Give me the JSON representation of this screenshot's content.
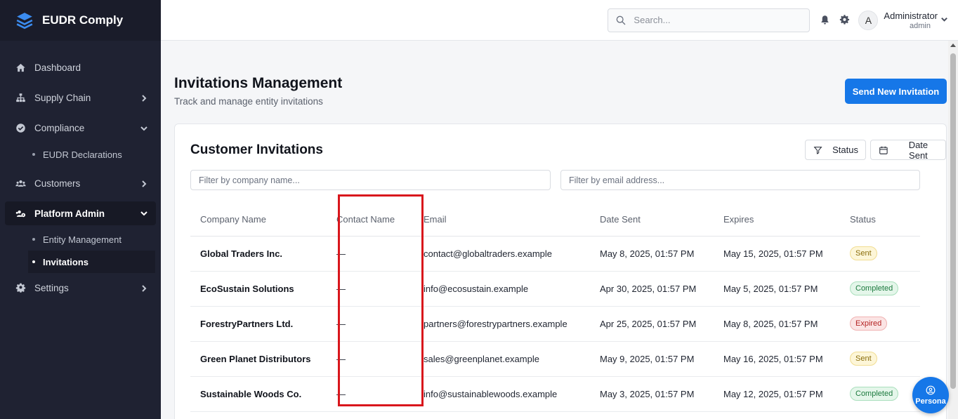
{
  "app": {
    "name": "EUDR Comply"
  },
  "sidebar": {
    "items": [
      {
        "label": "Dashboard",
        "icon": "home-icon"
      },
      {
        "label": "Supply Chain",
        "icon": "sitemap-icon"
      },
      {
        "label": "Compliance",
        "icon": "check-circle-icon"
      },
      {
        "label": "EUDR Declarations"
      },
      {
        "label": "Customers",
        "icon": "users-icon"
      },
      {
        "label": "Platform Admin",
        "icon": "users-cog-icon"
      },
      {
        "label": "Entity Management"
      },
      {
        "label": "Invitations"
      },
      {
        "label": "Settings",
        "icon": "gear-icon"
      }
    ]
  },
  "header": {
    "search_placeholder": "Search...",
    "user_initial": "A",
    "user_name": "Administrator",
    "user_role": "admin"
  },
  "page": {
    "title": "Invitations Management",
    "subtitle": "Track and manage entity invitations",
    "send_button": "Send New Invitation"
  },
  "card": {
    "title": "Customer Invitations",
    "status_filter": "Status",
    "date_filter": "Date Sent",
    "company_filter_placeholder": "Filter by company name...",
    "email_filter_placeholder": "Filter by email address..."
  },
  "table": {
    "headers": [
      "Company Name",
      "Contact Name",
      "Email",
      "Date Sent",
      "Expires",
      "Status"
    ],
    "rows": [
      {
        "company": "Global Traders Inc.",
        "contact": "—",
        "email": "contact@globaltraders.example",
        "sent": "May 8, 2025, 01:57 PM",
        "expires": "May 15, 2025, 01:57 PM",
        "status": "Sent"
      },
      {
        "company": "EcoSustain Solutions",
        "contact": "—",
        "email": "info@ecosustain.example",
        "sent": "Apr 30, 2025, 01:57 PM",
        "expires": "May 5, 2025, 01:57 PM",
        "status": "Completed"
      },
      {
        "company": "ForestryPartners Ltd.",
        "contact": "—",
        "email": "partners@forestrypartners.example",
        "sent": "Apr 25, 2025, 01:57 PM",
        "expires": "May 8, 2025, 01:57 PM",
        "status": "Expired"
      },
      {
        "company": "Green Planet Distributors",
        "contact": "—",
        "email": "sales@greenplanet.example",
        "sent": "May 9, 2025, 01:57 PM",
        "expires": "May 16, 2025, 01:57 PM",
        "status": "Sent"
      },
      {
        "company": "Sustainable Woods Co.",
        "contact": "—",
        "email": "info@sustainablewoods.example",
        "sent": "May 3, 2025, 01:57 PM",
        "expires": "May 12, 2025, 01:57 PM",
        "status": "Completed"
      }
    ]
  },
  "persona": {
    "label": "Persona"
  },
  "colors": {
    "accent": "#1677e8",
    "sidebar": "#1f2232",
    "highlight": "#d9161c"
  }
}
